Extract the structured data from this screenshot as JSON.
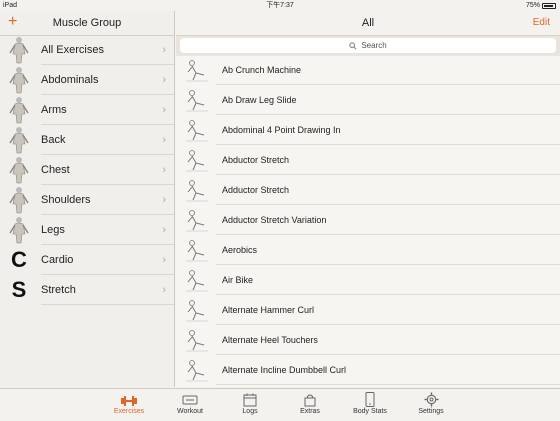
{
  "status": {
    "device": "iPad",
    "time": "下午7:37",
    "battery": "75%"
  },
  "left": {
    "add_label": "+",
    "title": "Muscle Group",
    "items": [
      {
        "label": "All Exercises",
        "icon": "full-body-figure-icon"
      },
      {
        "label": "Abdominals",
        "icon": "abdominals-muscle-icon"
      },
      {
        "label": "Arms",
        "icon": "arms-muscle-icon"
      },
      {
        "label": "Back",
        "icon": "back-muscle-icon"
      },
      {
        "label": "Chest",
        "icon": "chest-muscle-icon"
      },
      {
        "label": "Shoulders",
        "icon": "shoulders-muscle-icon"
      },
      {
        "label": "Legs",
        "icon": "legs-muscle-icon"
      },
      {
        "label": "Cardio",
        "icon": "letter-c-icon",
        "letter": "C"
      },
      {
        "label": "Stretch",
        "icon": "letter-s-icon",
        "letter": "S"
      }
    ]
  },
  "right": {
    "title": "All",
    "edit_label": "Edit",
    "search_placeholder": "Search",
    "exercises": [
      "Ab Crunch Machine",
      "Ab Draw Leg Slide",
      "Abdominal 4 Point Drawing In",
      "Abductor Stretch",
      "Adductor Stretch",
      "Adductor Stretch Variation",
      "Aerobics",
      "Air Bike",
      "Alternate Hammer Curl",
      "Alternate Heel Touchers",
      "Alternate Incline Dumbbell Curl"
    ]
  },
  "tabs": [
    {
      "label": "Exercises",
      "icon": "dumbbell-icon",
      "active": true
    },
    {
      "label": "Workout",
      "icon": "workout-icon",
      "active": false
    },
    {
      "label": "Logs",
      "icon": "calendar-icon",
      "active": false
    },
    {
      "label": "Extras",
      "icon": "bag-icon",
      "active": false
    },
    {
      "label": "Body Stats",
      "icon": "phone-stats-icon",
      "active": false
    },
    {
      "label": "Settings",
      "icon": "gear-icon",
      "active": false
    }
  ],
  "colors": {
    "accent": "#e0652b",
    "background": "#f4f2ee"
  }
}
